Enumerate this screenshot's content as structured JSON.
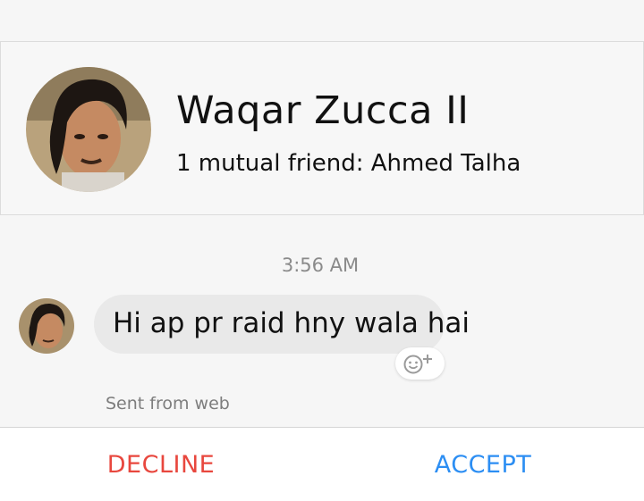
{
  "profile": {
    "name": "Waqar Zucca II",
    "mutual_friends": "1 mutual friend: Ahmed Talha"
  },
  "conversation": {
    "timestamp": "3:56 AM",
    "message_text": "Hi ap pr raid hny wala hai",
    "sent_from": "Sent from web",
    "reaction_icon": "add-reaction-icon"
  },
  "actions": {
    "decline_label": "DECLINE",
    "accept_label": "ACCEPT"
  },
  "colors": {
    "decline": "#e8473e",
    "accept": "#2c8ef3",
    "bubble": "#e9e9e9",
    "background": "#f6f6f6"
  }
}
